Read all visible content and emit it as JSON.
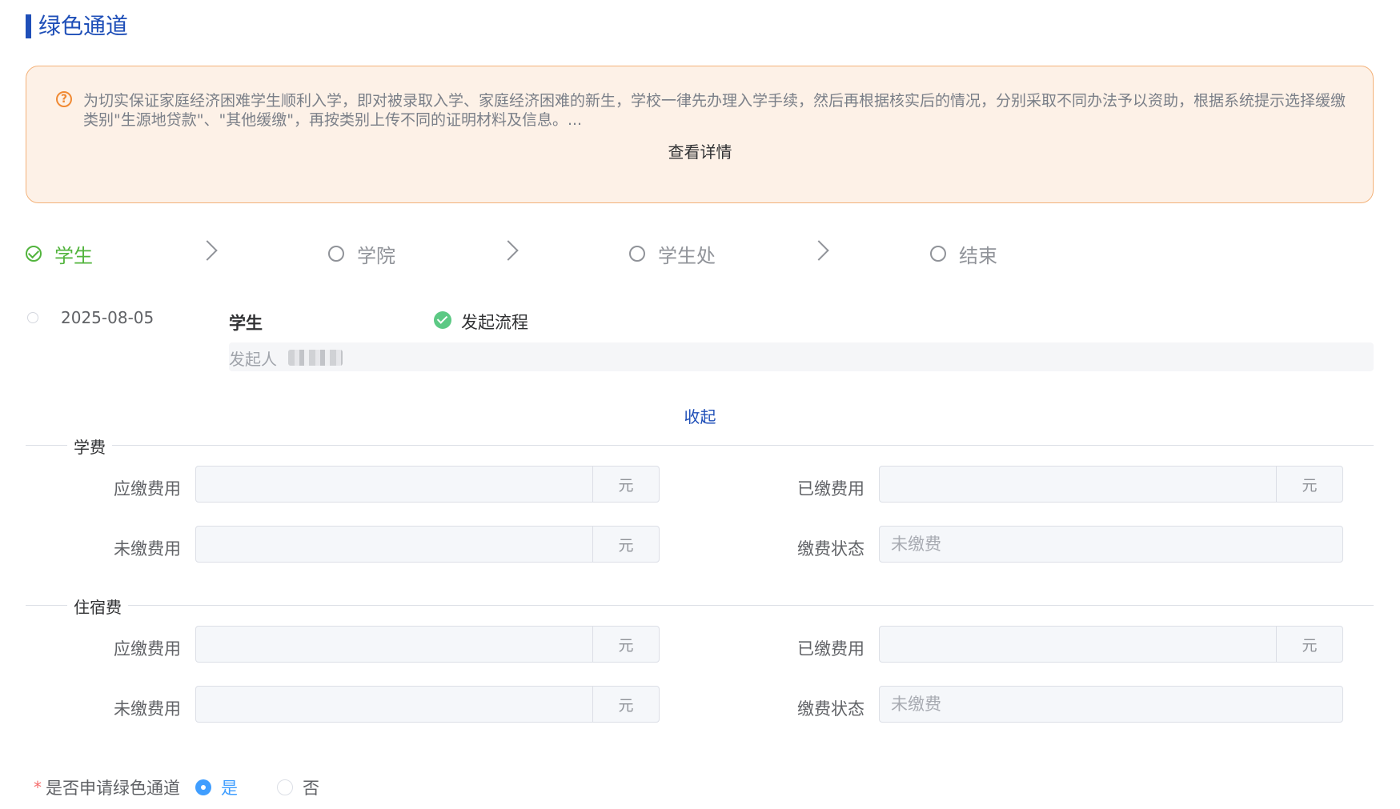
{
  "page_title": "绿色通道",
  "notice": {
    "text": "为切实保证家庭经济困难学生顺利入学，即对被录取入学、家庭经济困难的新生，学校一律先办理入学手续，然后再根据核实后的情况，分别采取不同办法予以资助，根据系统提示选择缓缴类别\"生源地贷款\"、\"其他缓缴\"，再按类别上传不同的证明材料及信息。...",
    "detail_link": "查看详情",
    "icon": "question-circle-icon"
  },
  "steps": [
    {
      "label": "学生",
      "state": "done"
    },
    {
      "label": "学院",
      "state": "pending"
    },
    {
      "label": "学生处",
      "state": "pending"
    },
    {
      "label": "结束",
      "state": "pending"
    }
  ],
  "timeline": {
    "date": "2025-08-05",
    "role": "学生",
    "status": "发起流程",
    "initiator_label": "发起人"
  },
  "collapse_label": "收起",
  "unit": "元",
  "sections": [
    {
      "title": "学费",
      "payable_label": "应缴费用",
      "payable_value": "",
      "paid_label": "已缴费用",
      "paid_value": "",
      "unpaid_label": "未缴费用",
      "unpaid_value": "",
      "status_label": "缴费状态",
      "status_placeholder": "未缴费"
    },
    {
      "title": "住宿费",
      "payable_label": "应缴费用",
      "payable_value": "",
      "paid_label": "已缴费用",
      "paid_value": "",
      "unpaid_label": "未缴费用",
      "unpaid_value": "",
      "status_label": "缴费状态",
      "status_placeholder": "未缴费"
    }
  ],
  "apply": {
    "required_mark": "*",
    "label": "是否申请绿色通道",
    "options": [
      "是",
      "否"
    ],
    "selected": "是"
  },
  "colors": {
    "primary": "#1f4fb8",
    "success": "#52b43d",
    "warning": "#f08a34",
    "radio": "#409eff"
  }
}
